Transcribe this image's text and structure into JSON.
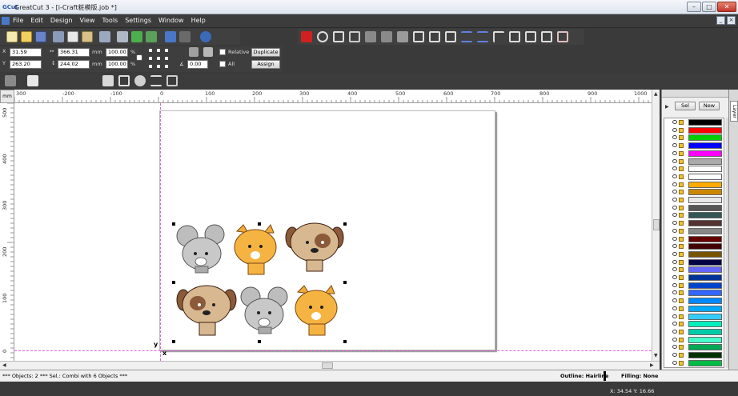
{
  "window": {
    "app_icon": "GCut",
    "title": "GreatCut 3 - [i-Craft粧模版.job *]",
    "buttons": [
      "–",
      "□",
      "✕"
    ]
  },
  "menu": {
    "items": [
      "File",
      "Edit",
      "Design",
      "View",
      "Tools",
      "Settings",
      "Window",
      "Help"
    ],
    "mdi_buttons": [
      "_",
      "×"
    ]
  },
  "props": {
    "x_label": "X",
    "x_value": "31.59",
    "y_label": "Y",
    "y_value": "263.20",
    "w_value": "366.31",
    "h_value": "244.02",
    "unit1": "mm",
    "unit2": "mm",
    "scale_x": "100.00",
    "scale_y": "100.00",
    "pct1": "%",
    "pct2": "%",
    "angle_value": "0.00",
    "relative_label": "Relative",
    "all_label": "All",
    "duplicate_label": "Duplicate",
    "assign_label": "Assign"
  },
  "ruler": {
    "corner": "mm",
    "h_labels": [
      "300",
      "-200",
      "-100",
      "0",
      "100",
      "200",
      "300",
      "400",
      "500",
      "600",
      "700",
      "800",
      "900",
      "1000"
    ],
    "v_labels": [
      "500",
      "400",
      "300",
      "200",
      "100",
      "0"
    ]
  },
  "canvas": {
    "axis_y": "y",
    "axis_x": "x"
  },
  "panel": {
    "sel_label": "Sel",
    "new_label": "New",
    "tab_label": "Layer",
    "layer_colors": [
      "#000000",
      "#ff0000",
      "#00cc00",
      "#0000ff",
      "#ff00ff",
      "#aaaaaa",
      "#ffffff",
      "#ffffff",
      "#ffaa00",
      "#cc8800",
      "#e8e8e8",
      "#555555",
      "#335555",
      "#553333",
      "#888888",
      "#660000",
      "#440000",
      "#775500",
      "#000044",
      "#6666ff",
      "#003399",
      "#0044cc",
      "#3366ff",
      "#0088ff",
      "#00aaff",
      "#33ccff",
      "#00eebb",
      "#00ccaa",
      "#44ffcc",
      "#00aa55",
      "#003300",
      "#00bb44"
    ]
  },
  "status": {
    "left": "*** Objects: 2 *** Sel.: Combi with 6 Objects ***",
    "outline": "Outline: Hairline",
    "filling": "Filling: None",
    "coords": "X: 34.54 Y: 16.66"
  }
}
